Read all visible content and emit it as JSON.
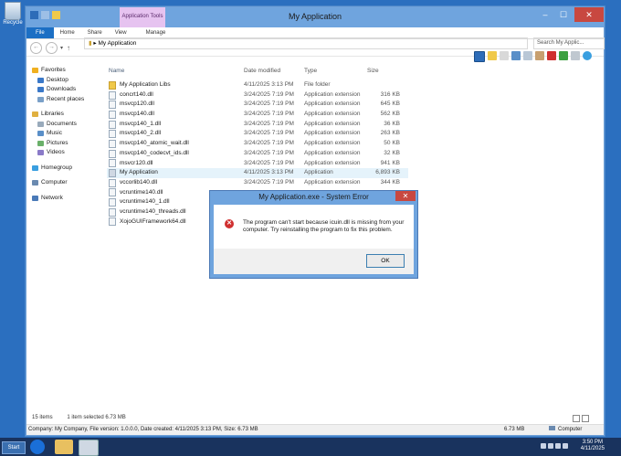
{
  "desktop": {
    "recycle_label": "Recycle"
  },
  "window": {
    "title": "My Application",
    "context_tab": "Application Tools",
    "tabs": [
      "File",
      "Home",
      "Share",
      "View",
      "Manage"
    ]
  },
  "address": {
    "path": "My Application",
    "search_placeholder": "Search My Applic..."
  },
  "nav": {
    "favorites": "Favorites",
    "favorites_items": [
      "Desktop",
      "Downloads",
      "Recent places"
    ],
    "libraries": "Libraries",
    "libraries_items": [
      "Documents",
      "Music",
      "Pictures",
      "Videos"
    ],
    "homegroup": "Homegroup",
    "computer": "Computer",
    "network": "Network"
  },
  "columns": {
    "name": "Name",
    "date": "Date modified",
    "type": "Type",
    "size": "Size"
  },
  "files": [
    {
      "name": "My Application Libs",
      "date": "4/11/2025 3:13 PM",
      "type": "File folder",
      "size": "",
      "kind": "folder"
    },
    {
      "name": "concrt140.dll",
      "date": "3/24/2025 7:19 PM",
      "type": "Application extension",
      "size": "316 KB",
      "kind": "dll"
    },
    {
      "name": "msvcp120.dll",
      "date": "3/24/2025 7:19 PM",
      "type": "Application extension",
      "size": "645 KB",
      "kind": "dll"
    },
    {
      "name": "msvcp140.dll",
      "date": "3/24/2025 7:19 PM",
      "type": "Application extension",
      "size": "562 KB",
      "kind": "dll"
    },
    {
      "name": "msvcp140_1.dll",
      "date": "3/24/2025 7:19 PM",
      "type": "Application extension",
      "size": "36 KB",
      "kind": "dll"
    },
    {
      "name": "msvcp140_2.dll",
      "date": "3/24/2025 7:19 PM",
      "type": "Application extension",
      "size": "263 KB",
      "kind": "dll"
    },
    {
      "name": "msvcp140_atomic_wait.dll",
      "date": "3/24/2025 7:19 PM",
      "type": "Application extension",
      "size": "50 KB",
      "kind": "dll"
    },
    {
      "name": "msvcp140_codecvt_ids.dll",
      "date": "3/24/2025 7:19 PM",
      "type": "Application extension",
      "size": "32 KB",
      "kind": "dll"
    },
    {
      "name": "msvcr120.dll",
      "date": "3/24/2025 7:19 PM",
      "type": "Application extension",
      "size": "941 KB",
      "kind": "dll"
    },
    {
      "name": "My Application",
      "date": "4/11/2025 3:13 PM",
      "type": "Application",
      "size": "6,893 KB",
      "kind": "app",
      "selected": true
    },
    {
      "name": "vccorlib140.dll",
      "date": "3/24/2025 7:19 PM",
      "type": "Application extension",
      "size": "344 KB",
      "kind": "dll"
    },
    {
      "name": "vcruntime140.dll",
      "date": "",
      "type": "",
      "size": "",
      "kind": "dll"
    },
    {
      "name": "vcruntime140_1.dll",
      "date": "",
      "type": "",
      "size": "",
      "kind": "dll"
    },
    {
      "name": "vcruntime140_threads.dll",
      "date": "",
      "type": "",
      "size": "",
      "kind": "dll"
    },
    {
      "name": "XojoGUIFramework64.dll",
      "date": "",
      "type": "",
      "size": "",
      "kind": "dll"
    }
  ],
  "status": {
    "items": "15 items",
    "selected": "1 item selected  6.73 MB"
  },
  "details": {
    "text": "Company: My Company, File version: 1.0.0.0, Date created: 4/11/2025 3:13 PM, Size: 6.73 MB",
    "size": "6.73 MB",
    "location": "Computer"
  },
  "dialog": {
    "title": "My Application.exe - System Error",
    "message": "The program can't start because icuin.dll is missing from your computer. Try reinstalling the program to fix this problem.",
    "ok": "OK"
  },
  "taskbar": {
    "start": "Start",
    "time": "3:50 PM",
    "date": "4/11/2025"
  }
}
